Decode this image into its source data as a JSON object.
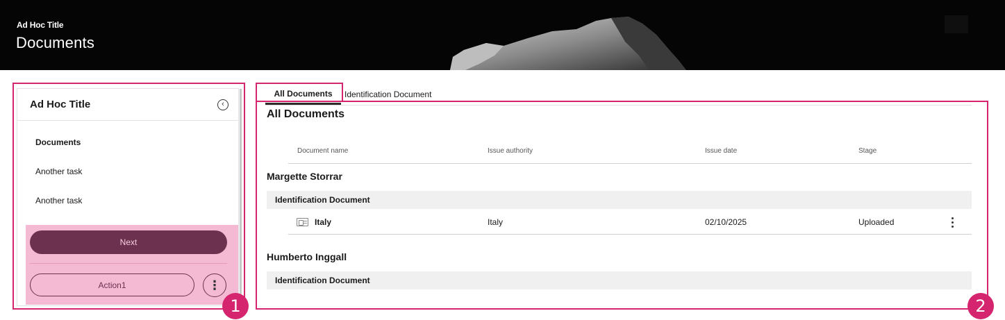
{
  "header": {
    "subtitle": "Ad Hoc Title",
    "title": "Documents"
  },
  "side_panel": {
    "title": "Ad Hoc Title",
    "tasks": [
      {
        "label": "Documents",
        "active": true
      },
      {
        "label": "Another task",
        "active": false
      },
      {
        "label": "Another task",
        "active": false
      }
    ],
    "next_label": "Next",
    "action1_label": "Action1"
  },
  "annotations": {
    "badge_1": "1",
    "badge_2": "2"
  },
  "tabs": [
    {
      "label": "All Documents",
      "active": true
    },
    {
      "label": "Identification Document",
      "active": false
    }
  ],
  "main": {
    "title": "All Documents",
    "columns": [
      "Document name",
      "Issue authority",
      "Issue date",
      "Stage"
    ],
    "groups": [
      {
        "person": "Margette Storrar",
        "category": "Identification Document",
        "rows": [
          {
            "name": "Italy",
            "authority": "Italy",
            "date": "02/10/2025",
            "stage": "Uploaded"
          }
        ]
      },
      {
        "person": "Humberto Inggall",
        "category": "Identification Document",
        "rows": []
      }
    ]
  },
  "colors": {
    "accent": "#d4256e",
    "primary_button": "#6d3150",
    "highlight_area": "#f5bad3"
  },
  "icons": [
    "collapse-left-icon",
    "more-vertical-icon",
    "id-card-icon"
  ]
}
